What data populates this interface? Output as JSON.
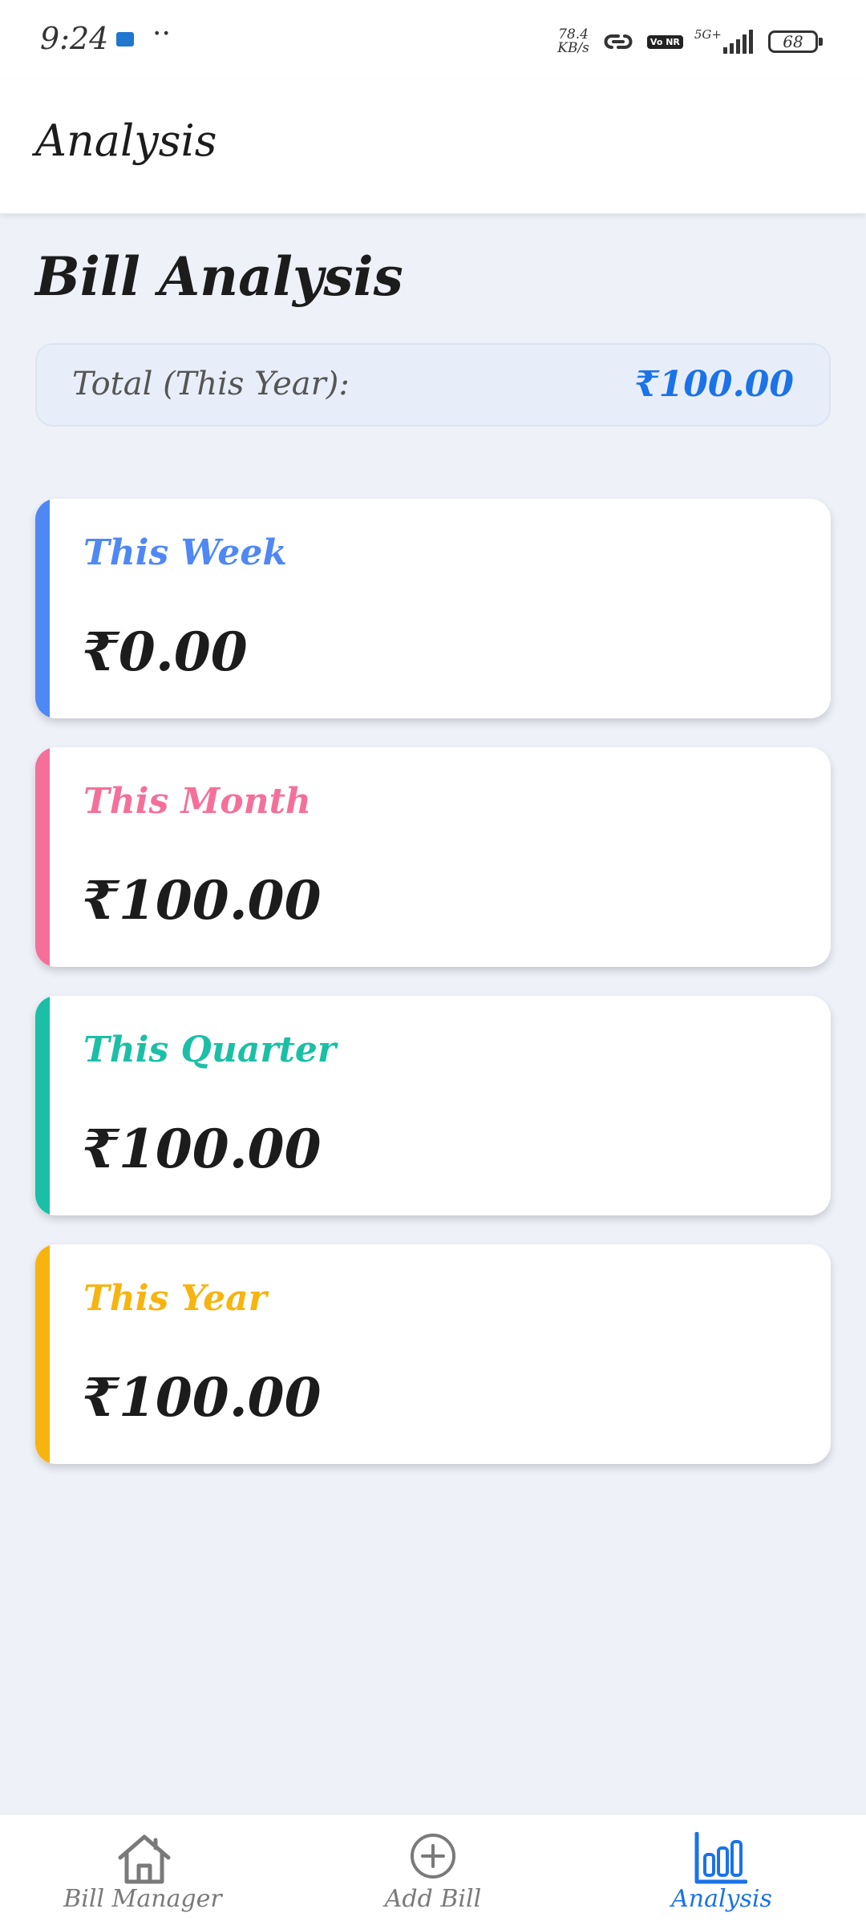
{
  "status_bar": {
    "time": "9:24",
    "dots": "··",
    "net_speed_value": "78.4",
    "net_speed_unit": "KB/s",
    "volte": "Vo NR",
    "network": "5G+",
    "battery": "68"
  },
  "app_bar": {
    "title": "Analysis"
  },
  "main": {
    "heading": "Bill Analysis",
    "total_label": "Total (This Year):",
    "total_value": "₹100.00",
    "cards": [
      {
        "title": "This Week",
        "value": "₹0.00",
        "accent": "#4f88f5"
      },
      {
        "title": "This Month",
        "value": "₹100.00",
        "accent": "#f4709a"
      },
      {
        "title": "This Quarter",
        "value": "₹100.00",
        "accent": "#1bbfa6"
      },
      {
        "title": "This Year",
        "value": "₹100.00",
        "accent": "#f7b40f"
      }
    ]
  },
  "bottom_nav": {
    "items": [
      {
        "label": "Bill Manager",
        "icon": "home-icon",
        "active": false
      },
      {
        "label": "Add Bill",
        "icon": "plus-circle-icon",
        "active": false
      },
      {
        "label": "Analysis",
        "icon": "bar-chart-icon",
        "active": true
      }
    ]
  },
  "colors": {
    "accent": "#1a73e8",
    "background": "#eef1f8"
  }
}
